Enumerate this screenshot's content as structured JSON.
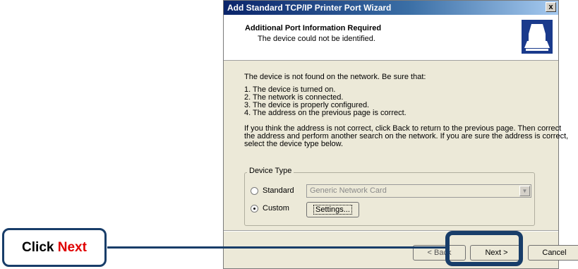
{
  "window": {
    "title": "Add Standard TCP/IP Printer Port Wizard",
    "close_glyph": "x"
  },
  "header": {
    "title": "Additional Port Information Required",
    "subtitle": "The device could not be identified.",
    "icon": "printer-icon"
  },
  "body": {
    "intro": "The device is not found on the network.  Be sure that:",
    "checklist": [
      "1.  The device is turned on.",
      "2.  The network is connected.",
      "3.  The device is properly configured.",
      "4.  The address on the previous page is correct."
    ],
    "instructions": [
      "If you think the address is not correct, click Back to return to the previous page.  Then correct",
      "the address and perform another search on the network.  If you are sure the address is correct,",
      "select the device type below."
    ]
  },
  "device_type": {
    "legend": "Device Type",
    "standard_label": "Standard",
    "standard_value": "Generic Network Card",
    "custom_label": "Custom",
    "selected": "Custom",
    "settings_label": "Settings..."
  },
  "buttons": {
    "back": "< Back",
    "next": "Next >",
    "cancel": "Cancel"
  },
  "callout": {
    "prefix": "Click",
    "accent": "Next",
    "border_color": "#183d69",
    "accent_color": "#e00000"
  }
}
